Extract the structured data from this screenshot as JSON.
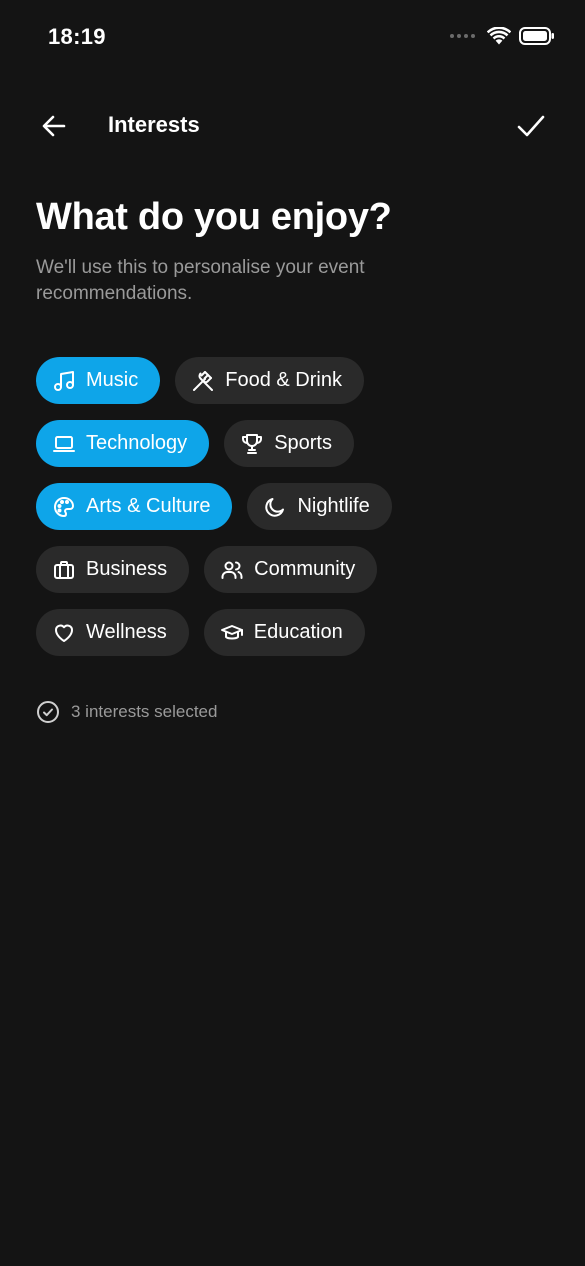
{
  "status": {
    "time": "18:19"
  },
  "nav": {
    "title": "Interests"
  },
  "heading": "What do you enjoy?",
  "subtitle": "We'll use this to personalise your event recommendations.",
  "interests": [
    {
      "label": "Music",
      "icon": "music-note-icon",
      "selected": true
    },
    {
      "label": "Food & Drink",
      "icon": "fork-knife-icon",
      "selected": false
    },
    {
      "label": "Technology",
      "icon": "laptop-icon",
      "selected": true
    },
    {
      "label": "Sports",
      "icon": "trophy-icon",
      "selected": false
    },
    {
      "label": "Arts & Culture",
      "icon": "palette-icon",
      "selected": true
    },
    {
      "label": "Nightlife",
      "icon": "moon-icon",
      "selected": false
    },
    {
      "label": "Business",
      "icon": "briefcase-icon",
      "selected": false
    },
    {
      "label": "Community",
      "icon": "users-icon",
      "selected": false
    },
    {
      "label": "Wellness",
      "icon": "heart-icon",
      "selected": false
    },
    {
      "label": "Education",
      "icon": "graduation-cap-icon",
      "selected": false
    }
  ],
  "selected_count_text": "3 interests selected",
  "colors": {
    "background": "#141414",
    "chip": "#2a2a2a",
    "chip_selected": "#0ea5e9",
    "muted_text": "#9a9a9a"
  }
}
